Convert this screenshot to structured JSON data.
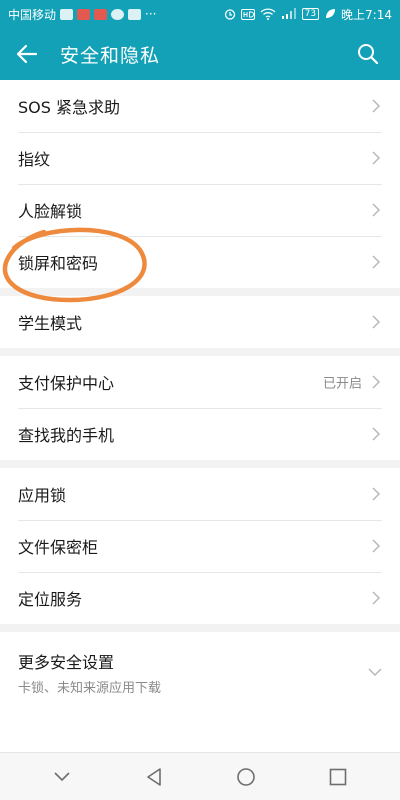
{
  "status_bar": {
    "carrier": "中国移动",
    "more": "···",
    "battery": "73",
    "time": "晚上7:14"
  },
  "header": {
    "title": "安全和隐私",
    "back_icon": "back-arrow-icon",
    "search_icon": "search-icon"
  },
  "groups": [
    {
      "items": [
        {
          "label": "SOS 紧急求助"
        },
        {
          "label": "指纹"
        },
        {
          "label": "人脸解锁"
        },
        {
          "label": "锁屏和密码"
        }
      ]
    },
    {
      "items": [
        {
          "label": "学生模式"
        }
      ]
    },
    {
      "items": [
        {
          "label": "支付保护中心",
          "status": "已开启"
        },
        {
          "label": "查找我的手机"
        }
      ]
    },
    {
      "items": [
        {
          "label": "应用锁"
        },
        {
          "label": "文件保密柜"
        },
        {
          "label": "定位服务"
        }
      ]
    },
    {
      "items": [
        {
          "label": "更多安全设置",
          "sublabel": "卡锁、未知来源应用下载"
        }
      ]
    }
  ],
  "colors": {
    "header_bg": "#12a1b6",
    "annotation": "#ee8a3d"
  }
}
